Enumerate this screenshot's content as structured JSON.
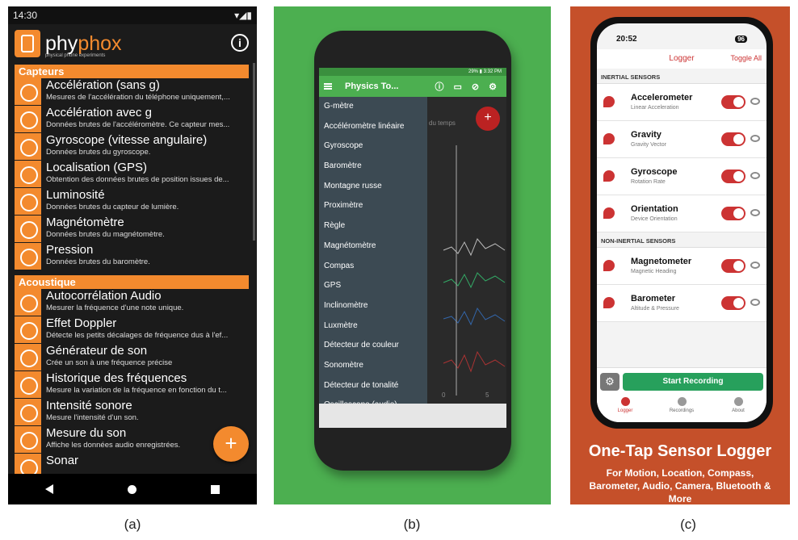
{
  "captions": {
    "a": "(a)",
    "b": "(b)",
    "c": "(c)"
  },
  "panel_a": {
    "status_time": "14:30",
    "status_icons": "▾◢▮",
    "brand_a": "phy",
    "brand_b": "phox",
    "tagline": "physical phone experiments",
    "info_icon": "i",
    "section_capteurs": "Capteurs",
    "capteurs": [
      {
        "title": "Accélération (sans g)",
        "desc": "Mesures de l'accélération du téléphone uniquement,..."
      },
      {
        "title": "Accélération avec g",
        "desc": "Données brutes de l'accéléromètre. Ce capteur mes..."
      },
      {
        "title": "Gyroscope (vitesse angulaire)",
        "desc": "Données brutes du gyroscope."
      },
      {
        "title": "Localisation (GPS)",
        "desc": "Obtention des données brutes de position issues de..."
      },
      {
        "title": "Luminosité",
        "desc": "Données brutes du capteur de lumière."
      },
      {
        "title": "Magnétomètre",
        "desc": "Données brutes du magnétomètre."
      },
      {
        "title": "Pression",
        "desc": "Données brutes du baromètre."
      }
    ],
    "section_acoustique": "Acoustique",
    "acoustique": [
      {
        "title": "Autocorrélation Audio",
        "desc": "Mesurer la fréquence d'une note unique."
      },
      {
        "title": "Effet Doppler",
        "desc": "Détecte les petits décalages de fréquence dus à l'ef..."
      },
      {
        "title": "Générateur de son",
        "desc": "Crée un son à une fréquence précise"
      },
      {
        "title": "Historique des fréquences",
        "desc": "Mesure la variation de la fréquence en fonction du t..."
      },
      {
        "title": "Intensité sonore",
        "desc": "Mesure l'intensité d'un son."
      },
      {
        "title": "Mesure du son",
        "desc": "Affiche les données audio enregistrées."
      },
      {
        "title": "Sonar",
        "desc": ""
      }
    ],
    "fab": "+"
  },
  "panel_b": {
    "status": "29% ▮ 3:32 PM",
    "title": "Physics To...",
    "drawer_items": [
      "G-mètre",
      "Accéléromètre linéaire",
      "Gyroscope",
      "Baromètre",
      "Montagne russe",
      "Proximètre",
      "Règle",
      "Magnétomètre",
      "Compas",
      "GPS",
      "Inclinomètre",
      "Luxmètre",
      "Détecteur de couleur",
      "Sonomètre",
      "Détecteur de tonalité",
      "Oscilloscope (audio)"
    ],
    "plot_label": "du temps",
    "axis_0": "0",
    "axis_5": "5",
    "fab": "+"
  },
  "panel_c": {
    "time": "20:52",
    "battery": "96",
    "title": "Logger",
    "toggle_all": "Toggle All",
    "inertial_header": "INERTIAL SENSORS",
    "inertial": [
      {
        "name": "Accelerometer",
        "sub": "Linear Acceleration"
      },
      {
        "name": "Gravity",
        "sub": "Gravity Vector"
      },
      {
        "name": "Gyroscope",
        "sub": "Rotation Rate"
      },
      {
        "name": "Orientation",
        "sub": "Device Orientation"
      }
    ],
    "noninertial_header": "NON-INERTIAL SENSORS",
    "noninertial": [
      {
        "name": "Magnetometer",
        "sub": "Magnetic Heading"
      },
      {
        "name": "Barometer",
        "sub": "Altitude & Pressure"
      }
    ],
    "start_recording": "Start Recording",
    "tabs": [
      "Logger",
      "Recordings",
      "About"
    ],
    "headline": "One-Tap Sensor Logger",
    "subline": "For Motion, Location, Compass, Barometer, Audio, Camera, Bluetooth & More"
  }
}
